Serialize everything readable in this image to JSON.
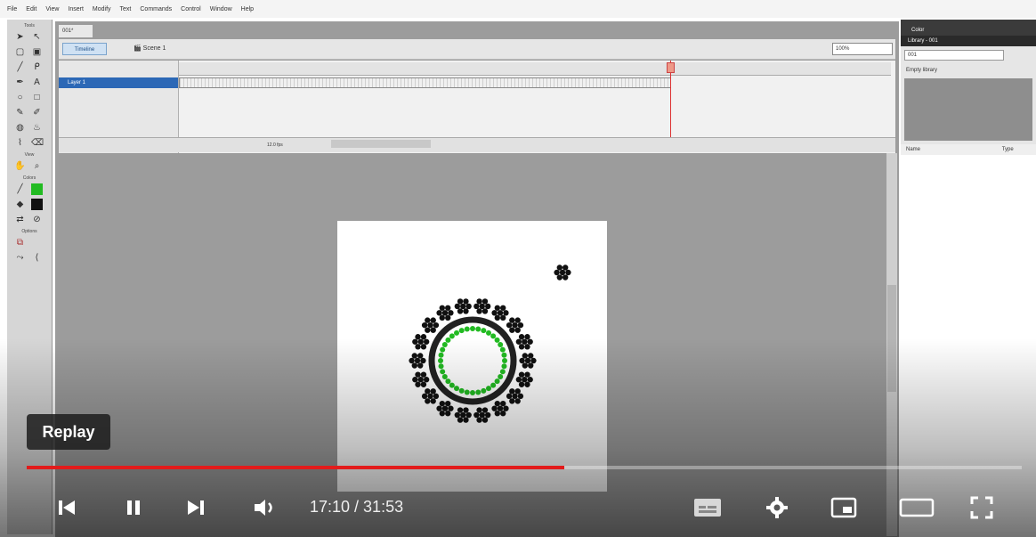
{
  "menubar": {
    "items": [
      "File",
      "Edit",
      "View",
      "Insert",
      "Modify",
      "Text",
      "Commands",
      "Control",
      "Window",
      "Help"
    ]
  },
  "toolbox": {
    "tools_label": "Tools",
    "view_label": "View",
    "colors_label": "Colors",
    "options_label": "Options",
    "fill_color": "#22bb22"
  },
  "document": {
    "tab": "001*",
    "timeline_button": "Timeline",
    "scene_label": "Scene 1",
    "zoom": "100%",
    "layer_name": "Layer 1",
    "fps": "12.0 fps"
  },
  "library": {
    "color_tab": "Color",
    "library_tab": "Library - 001",
    "selected": "001",
    "empty_text": "Empty library",
    "col_name": "Name",
    "col_type": "Type"
  },
  "player": {
    "replay_label": "Replay",
    "time": "17:10 / 31:53",
    "progress": 0.54,
    "accent": "#e21b1b"
  },
  "icons": [
    "skip-back-icon",
    "pause-icon",
    "skip-next-icon",
    "volume-icon",
    "subtitles-icon",
    "settings-icon",
    "miniplayer-icon",
    "theater-icon",
    "fullscreen-icon"
  ]
}
